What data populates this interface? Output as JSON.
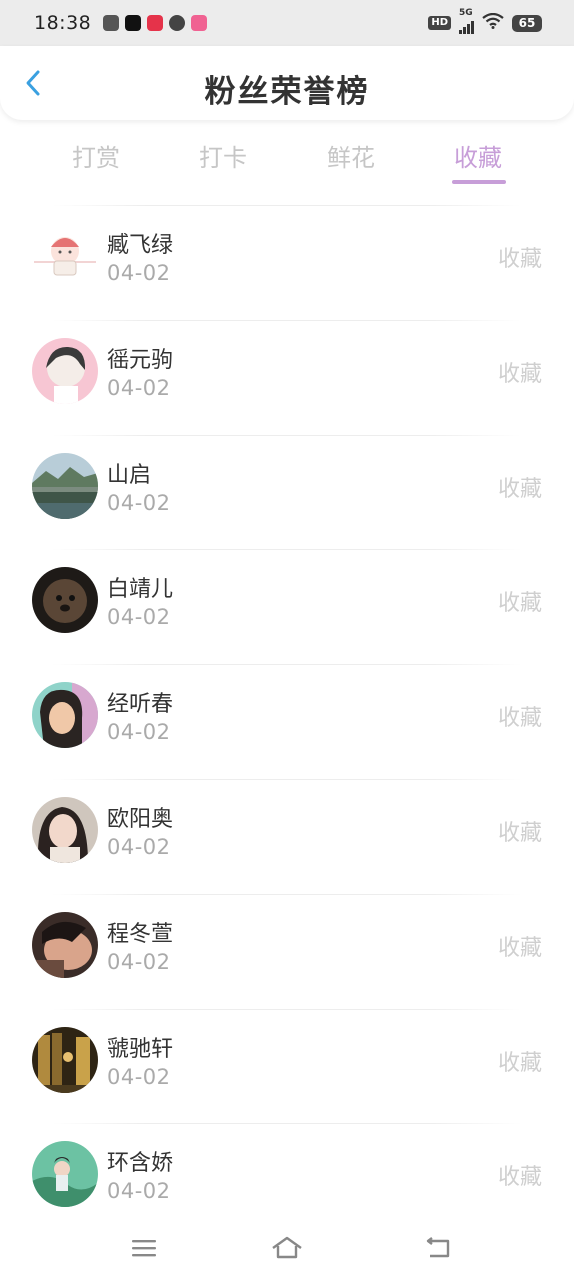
{
  "status_bar": {
    "time": "18:38",
    "network": "5G",
    "hd": "HD",
    "battery": "65",
    "app_icon_colors": [
      "#555555",
      "#111111",
      "#e5334a",
      "#444444",
      "#f06292"
    ]
  },
  "header": {
    "title": "粉丝荣誉榜",
    "back_icon": "chevron-left-icon",
    "back_color": "#3aa0e0"
  },
  "tabs": [
    {
      "label": "打赏",
      "active": false
    },
    {
      "label": "打卡",
      "active": false
    },
    {
      "label": "鲜花",
      "active": false
    },
    {
      "label": "收藏",
      "active": true
    }
  ],
  "accent_color": "#c79ed8",
  "list": [
    {
      "name": "臧飞绿",
      "date": "04-02",
      "action": "收藏"
    },
    {
      "name": "徭元驹",
      "date": "04-02",
      "action": "收藏"
    },
    {
      "name": "山启",
      "date": "04-02",
      "action": "收藏"
    },
    {
      "name": "白靖儿",
      "date": "04-02",
      "action": "收藏"
    },
    {
      "name": "经听春",
      "date": "04-02",
      "action": "收藏"
    },
    {
      "name": "欧阳奥",
      "date": "04-02",
      "action": "收藏"
    },
    {
      "name": "程冬萱",
      "date": "04-02",
      "action": "收藏"
    },
    {
      "name": "虢驰轩",
      "date": "04-02",
      "action": "收藏"
    },
    {
      "name": "环含娇",
      "date": "04-02",
      "action": "收藏"
    }
  ],
  "bottom_nav": {
    "icons": [
      "menu-icon",
      "home-icon",
      "back-icon"
    ]
  }
}
